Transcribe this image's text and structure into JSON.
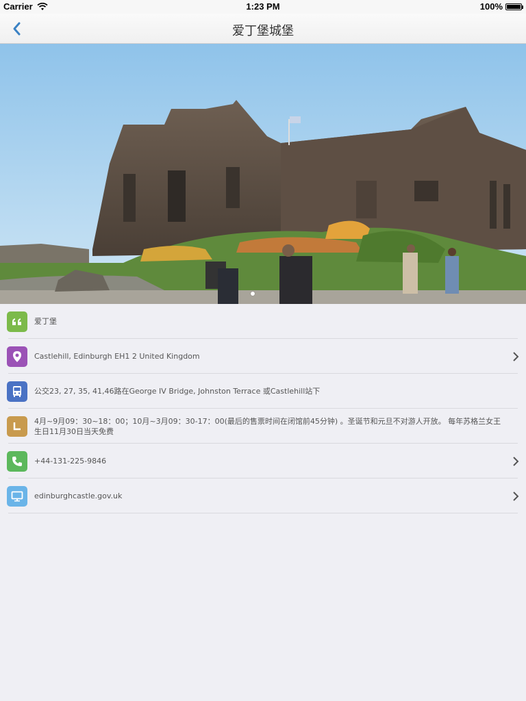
{
  "status_bar": {
    "carrier": "Carrier",
    "time": "1:23 PM",
    "battery": "100%"
  },
  "nav": {
    "title": "爱丁堡城堡"
  },
  "colors": {
    "accent": "#3b82c4",
    "quote": "#7cba4a",
    "location": "#9b52b6",
    "bus": "#4a72c4",
    "clock": "#c89a4e",
    "phone": "#5cb85c",
    "web": "#6ab4e8"
  },
  "info": {
    "name": "爱丁堡",
    "address": "Castlehill, Edinburgh EH1 2 United Kingdom",
    "transport": "公交23, 27, 35, 41,46路在George IV Bridge, Johnston Terrace 或Castlehill站下",
    "hours": "4月~9月09：30~18：00；10月~3月09：30-17：00(最后的售票时间在闭馆前45分钟) 。圣诞节和元旦不对游人开放。 每年苏格兰女王生日11月30日当天免费",
    "phone": "+44-131-225-9846",
    "website": "edinburghcastle.gov.uk"
  },
  "icons": [
    "quote-icon",
    "location-pin-icon",
    "bus-icon",
    "clock-icon",
    "phone-icon",
    "monitor-icon",
    "chevron-right-icon",
    "back-arrow-icon",
    "wifi-icon"
  ]
}
